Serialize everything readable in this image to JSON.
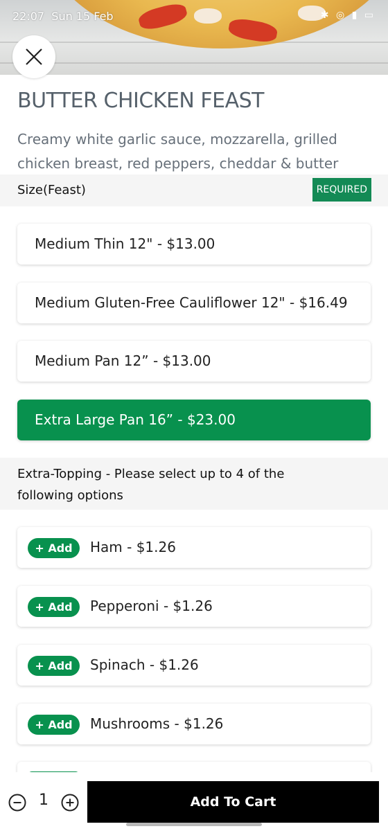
{
  "status_bar": {
    "time": "22:07",
    "date": "Sun 15 Feb",
    "icons": "✱ ◎ ▮ ▭"
  },
  "item": {
    "title": "BUTTER CHICKEN FEAST",
    "description": "Creamy white garlic sauce, mozzarella, grilled chicken breast, red peppers, cheddar & butter chicken sauce"
  },
  "size_section": {
    "label": "Size(Feast)",
    "badge": "REQUIRED",
    "options": [
      {
        "label": "Medium Thin 12\" - $13.00",
        "selected": false
      },
      {
        "label": "Medium Gluten-Free Cauliflower 12\" - $16.49",
        "selected": false
      },
      {
        "label": "Medium Pan 12” - $13.00",
        "selected": false
      },
      {
        "label": "Extra Large Pan 16” - $23.00",
        "selected": true
      }
    ]
  },
  "topping_section": {
    "label": "Extra-Topping - Please select up to 4 of the following options",
    "add_label": "+ Add",
    "items": [
      {
        "label": "Ham - $1.26"
      },
      {
        "label": "Pepperoni - $1.26"
      },
      {
        "label": "Spinach - $1.26"
      },
      {
        "label": "Mushrooms - $1.26"
      }
    ]
  },
  "bottom_bar": {
    "quantity": "1",
    "add_to_cart_label": "Add To Cart"
  },
  "colors": {
    "accent": "#08914e",
    "required_badge": "#138a55",
    "cart_button": "#000000",
    "title": "#56616b"
  },
  "icons": {
    "close": "close-icon",
    "minus": "minus-circle-icon",
    "plus": "plus-circle-icon"
  }
}
